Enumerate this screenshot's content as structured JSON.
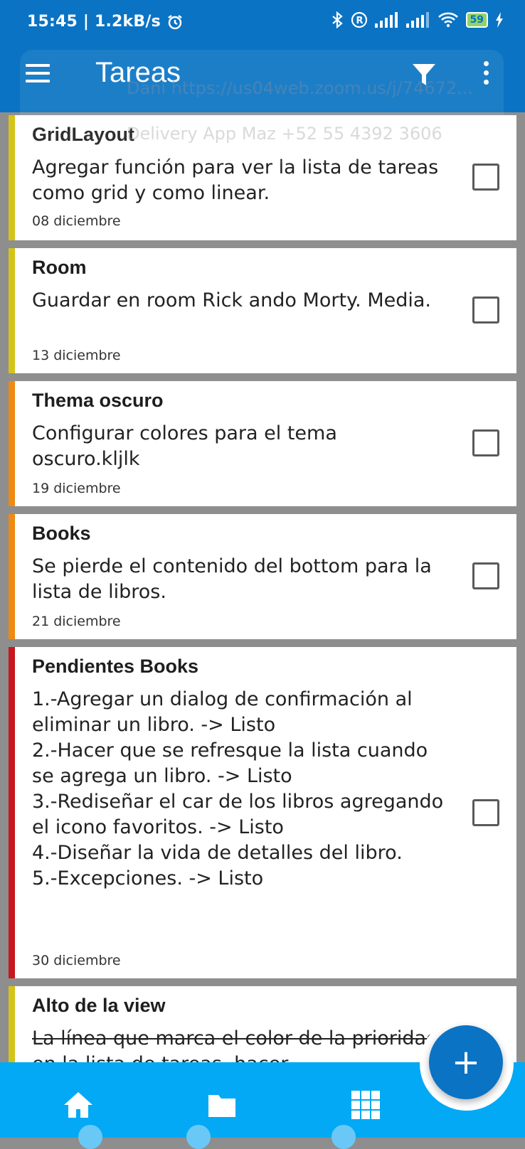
{
  "status": {
    "time_speed": "15:45 | 1.2kB/s",
    "battery": "59"
  },
  "appbar": {
    "title": "Tareas"
  },
  "notification": {
    "line1": "Dani  https://us04web.zoom.us/j/74672...",
    "line2": "Delivery App Maz  +52 55 4392 3606"
  },
  "tasks": [
    {
      "title": "GridLayout",
      "description": "Agregar función para ver la lista de tareas como grid y como linear.",
      "date": "08 diciembre",
      "priority_color": "#d4c419"
    },
    {
      "title": "Room",
      "description": "Guardar en room Rick ando Morty. Media.",
      "date": "13 diciembre",
      "priority_color": "#d4c419"
    },
    {
      "title": "Thema oscuro",
      "description": "Configurar colores para el tema oscuro.kljlk",
      "date": "19 diciembre",
      "priority_color": "#ef8a12"
    },
    {
      "title": "Books",
      "description": "Se pierde el contenido del bottom para la lista de libros.",
      "date": "21 diciembre",
      "priority_color": "#ef8a12"
    },
    {
      "title": "Pendientes Books",
      "description": "1.-Agregar un dialog de confirmación al eliminar un libro. -> Listo\n2.-Hacer que se refresque la lista cuando se agrega un libro. -> Listo\n3.-Rediseñar el car de los libros agregando el icono favoritos. -> Listo\n4.-Diseñar la vida de detalles del libro.\n5.-Excepciones. -> Listo",
      "date": "30 diciembre",
      "priority_color": "#c8161d"
    },
    {
      "title": "Alto de la view",
      "description": "La línea que marca el color de la prioridad en la lista de tareas, hacer",
      "date": "",
      "priority_color": "#d4c419"
    }
  ],
  "fab": {
    "label": "+"
  },
  "bottom_nav": [
    "home-icon",
    "folder-icon",
    "grid-icon"
  ]
}
